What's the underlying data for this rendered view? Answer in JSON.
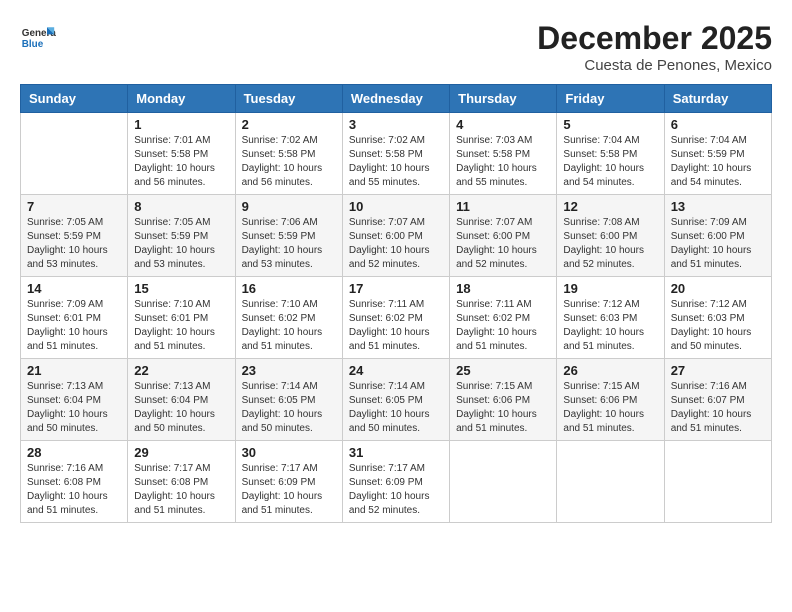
{
  "header": {
    "logo": {
      "general": "General",
      "blue": "Blue"
    },
    "month": "December 2025",
    "location": "Cuesta de Penones, Mexico"
  },
  "weekdays": [
    "Sunday",
    "Monday",
    "Tuesday",
    "Wednesday",
    "Thursday",
    "Friday",
    "Saturday"
  ],
  "weeks": [
    [
      {
        "day": "",
        "info": ""
      },
      {
        "day": "1",
        "info": "Sunrise: 7:01 AM\nSunset: 5:58 PM\nDaylight: 10 hours\nand 56 minutes."
      },
      {
        "day": "2",
        "info": "Sunrise: 7:02 AM\nSunset: 5:58 PM\nDaylight: 10 hours\nand 56 minutes."
      },
      {
        "day": "3",
        "info": "Sunrise: 7:02 AM\nSunset: 5:58 PM\nDaylight: 10 hours\nand 55 minutes."
      },
      {
        "day": "4",
        "info": "Sunrise: 7:03 AM\nSunset: 5:58 PM\nDaylight: 10 hours\nand 55 minutes."
      },
      {
        "day": "5",
        "info": "Sunrise: 7:04 AM\nSunset: 5:58 PM\nDaylight: 10 hours\nand 54 minutes."
      },
      {
        "day": "6",
        "info": "Sunrise: 7:04 AM\nSunset: 5:59 PM\nDaylight: 10 hours\nand 54 minutes."
      }
    ],
    [
      {
        "day": "7",
        "info": "Sunrise: 7:05 AM\nSunset: 5:59 PM\nDaylight: 10 hours\nand 53 minutes."
      },
      {
        "day": "8",
        "info": "Sunrise: 7:05 AM\nSunset: 5:59 PM\nDaylight: 10 hours\nand 53 minutes."
      },
      {
        "day": "9",
        "info": "Sunrise: 7:06 AM\nSunset: 5:59 PM\nDaylight: 10 hours\nand 53 minutes."
      },
      {
        "day": "10",
        "info": "Sunrise: 7:07 AM\nSunset: 6:00 PM\nDaylight: 10 hours\nand 52 minutes."
      },
      {
        "day": "11",
        "info": "Sunrise: 7:07 AM\nSunset: 6:00 PM\nDaylight: 10 hours\nand 52 minutes."
      },
      {
        "day": "12",
        "info": "Sunrise: 7:08 AM\nSunset: 6:00 PM\nDaylight: 10 hours\nand 52 minutes."
      },
      {
        "day": "13",
        "info": "Sunrise: 7:09 AM\nSunset: 6:00 PM\nDaylight: 10 hours\nand 51 minutes."
      }
    ],
    [
      {
        "day": "14",
        "info": "Sunrise: 7:09 AM\nSunset: 6:01 PM\nDaylight: 10 hours\nand 51 minutes."
      },
      {
        "day": "15",
        "info": "Sunrise: 7:10 AM\nSunset: 6:01 PM\nDaylight: 10 hours\nand 51 minutes."
      },
      {
        "day": "16",
        "info": "Sunrise: 7:10 AM\nSunset: 6:02 PM\nDaylight: 10 hours\nand 51 minutes."
      },
      {
        "day": "17",
        "info": "Sunrise: 7:11 AM\nSunset: 6:02 PM\nDaylight: 10 hours\nand 51 minutes."
      },
      {
        "day": "18",
        "info": "Sunrise: 7:11 AM\nSunset: 6:02 PM\nDaylight: 10 hours\nand 51 minutes."
      },
      {
        "day": "19",
        "info": "Sunrise: 7:12 AM\nSunset: 6:03 PM\nDaylight: 10 hours\nand 51 minutes."
      },
      {
        "day": "20",
        "info": "Sunrise: 7:12 AM\nSunset: 6:03 PM\nDaylight: 10 hours\nand 50 minutes."
      }
    ],
    [
      {
        "day": "21",
        "info": "Sunrise: 7:13 AM\nSunset: 6:04 PM\nDaylight: 10 hours\nand 50 minutes."
      },
      {
        "day": "22",
        "info": "Sunrise: 7:13 AM\nSunset: 6:04 PM\nDaylight: 10 hours\nand 50 minutes."
      },
      {
        "day": "23",
        "info": "Sunrise: 7:14 AM\nSunset: 6:05 PM\nDaylight: 10 hours\nand 50 minutes."
      },
      {
        "day": "24",
        "info": "Sunrise: 7:14 AM\nSunset: 6:05 PM\nDaylight: 10 hours\nand 50 minutes."
      },
      {
        "day": "25",
        "info": "Sunrise: 7:15 AM\nSunset: 6:06 PM\nDaylight: 10 hours\nand 51 minutes."
      },
      {
        "day": "26",
        "info": "Sunrise: 7:15 AM\nSunset: 6:06 PM\nDaylight: 10 hours\nand 51 minutes."
      },
      {
        "day": "27",
        "info": "Sunrise: 7:16 AM\nSunset: 6:07 PM\nDaylight: 10 hours\nand 51 minutes."
      }
    ],
    [
      {
        "day": "28",
        "info": "Sunrise: 7:16 AM\nSunset: 6:08 PM\nDaylight: 10 hours\nand 51 minutes."
      },
      {
        "day": "29",
        "info": "Sunrise: 7:17 AM\nSunset: 6:08 PM\nDaylight: 10 hours\nand 51 minutes."
      },
      {
        "day": "30",
        "info": "Sunrise: 7:17 AM\nSunset: 6:09 PM\nDaylight: 10 hours\nand 51 minutes."
      },
      {
        "day": "31",
        "info": "Sunrise: 7:17 AM\nSunset: 6:09 PM\nDaylight: 10 hours\nand 52 minutes."
      },
      {
        "day": "",
        "info": ""
      },
      {
        "day": "",
        "info": ""
      },
      {
        "day": "",
        "info": ""
      }
    ]
  ]
}
